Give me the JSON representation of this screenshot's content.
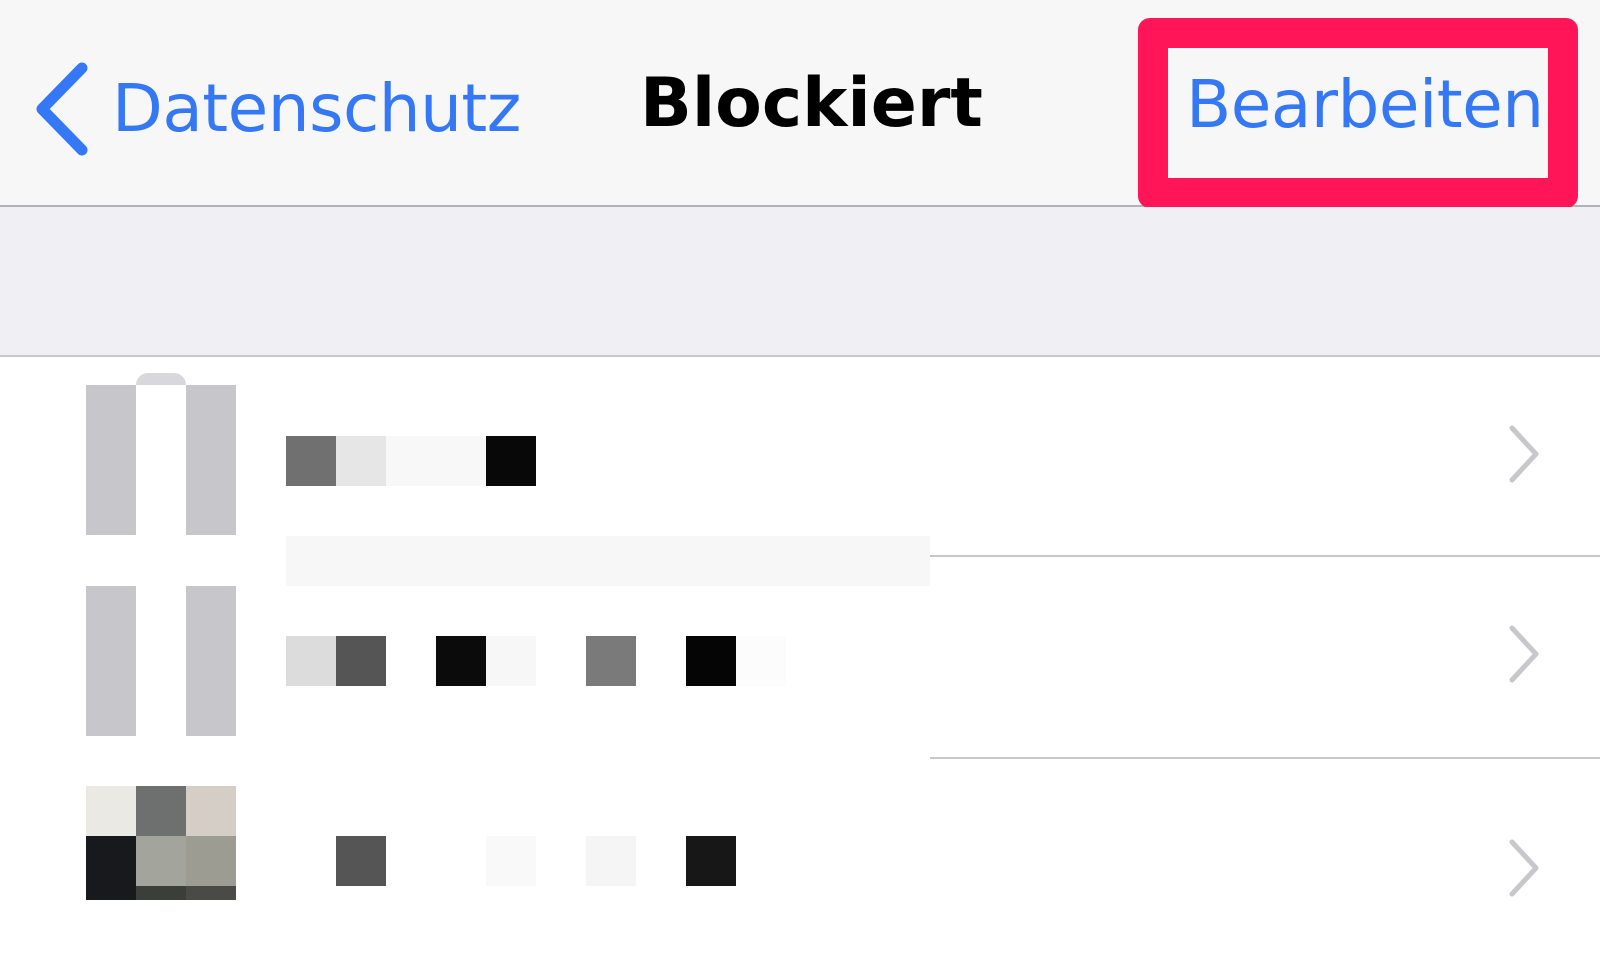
{
  "navbar": {
    "back_label": "Datenschutz",
    "title": "Blockiert",
    "edit_label": "Bearbeiten"
  },
  "icons": {
    "back": "chevron-left-icon",
    "row_disclosure": "chevron-right-icon"
  },
  "colors": {
    "accent": "#3478f6",
    "highlight": "#ff1558",
    "navbar_bg": "#f7f7f7",
    "group_bg": "#efeff4",
    "chevron": "#c7c7cc"
  },
  "blocked_contacts": {
    "count_visible": 3,
    "note": ""
  }
}
